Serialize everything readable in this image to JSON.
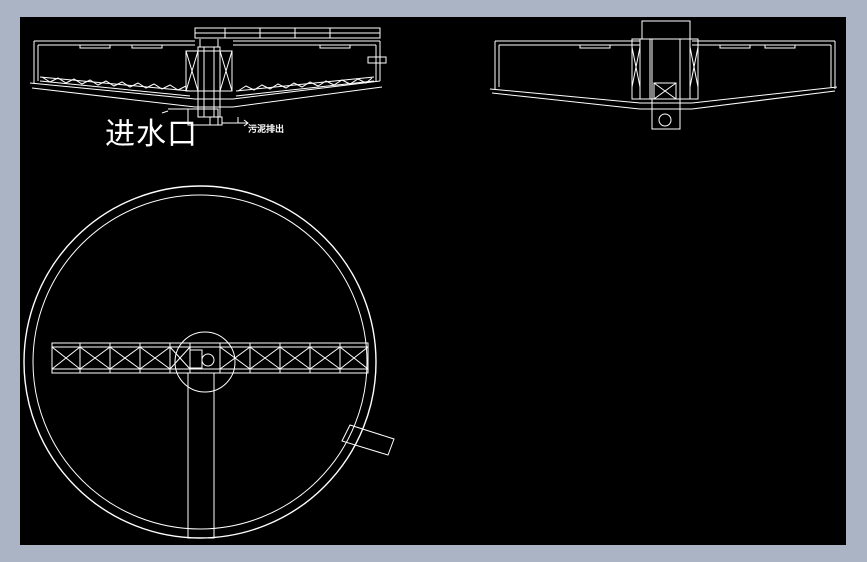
{
  "drawing": {
    "inlet_label": "进水口",
    "sludge_label": "污泥排出"
  },
  "colors": {
    "background": "#aab4c4",
    "canvas": "#000000",
    "linework": "#ffffff"
  }
}
